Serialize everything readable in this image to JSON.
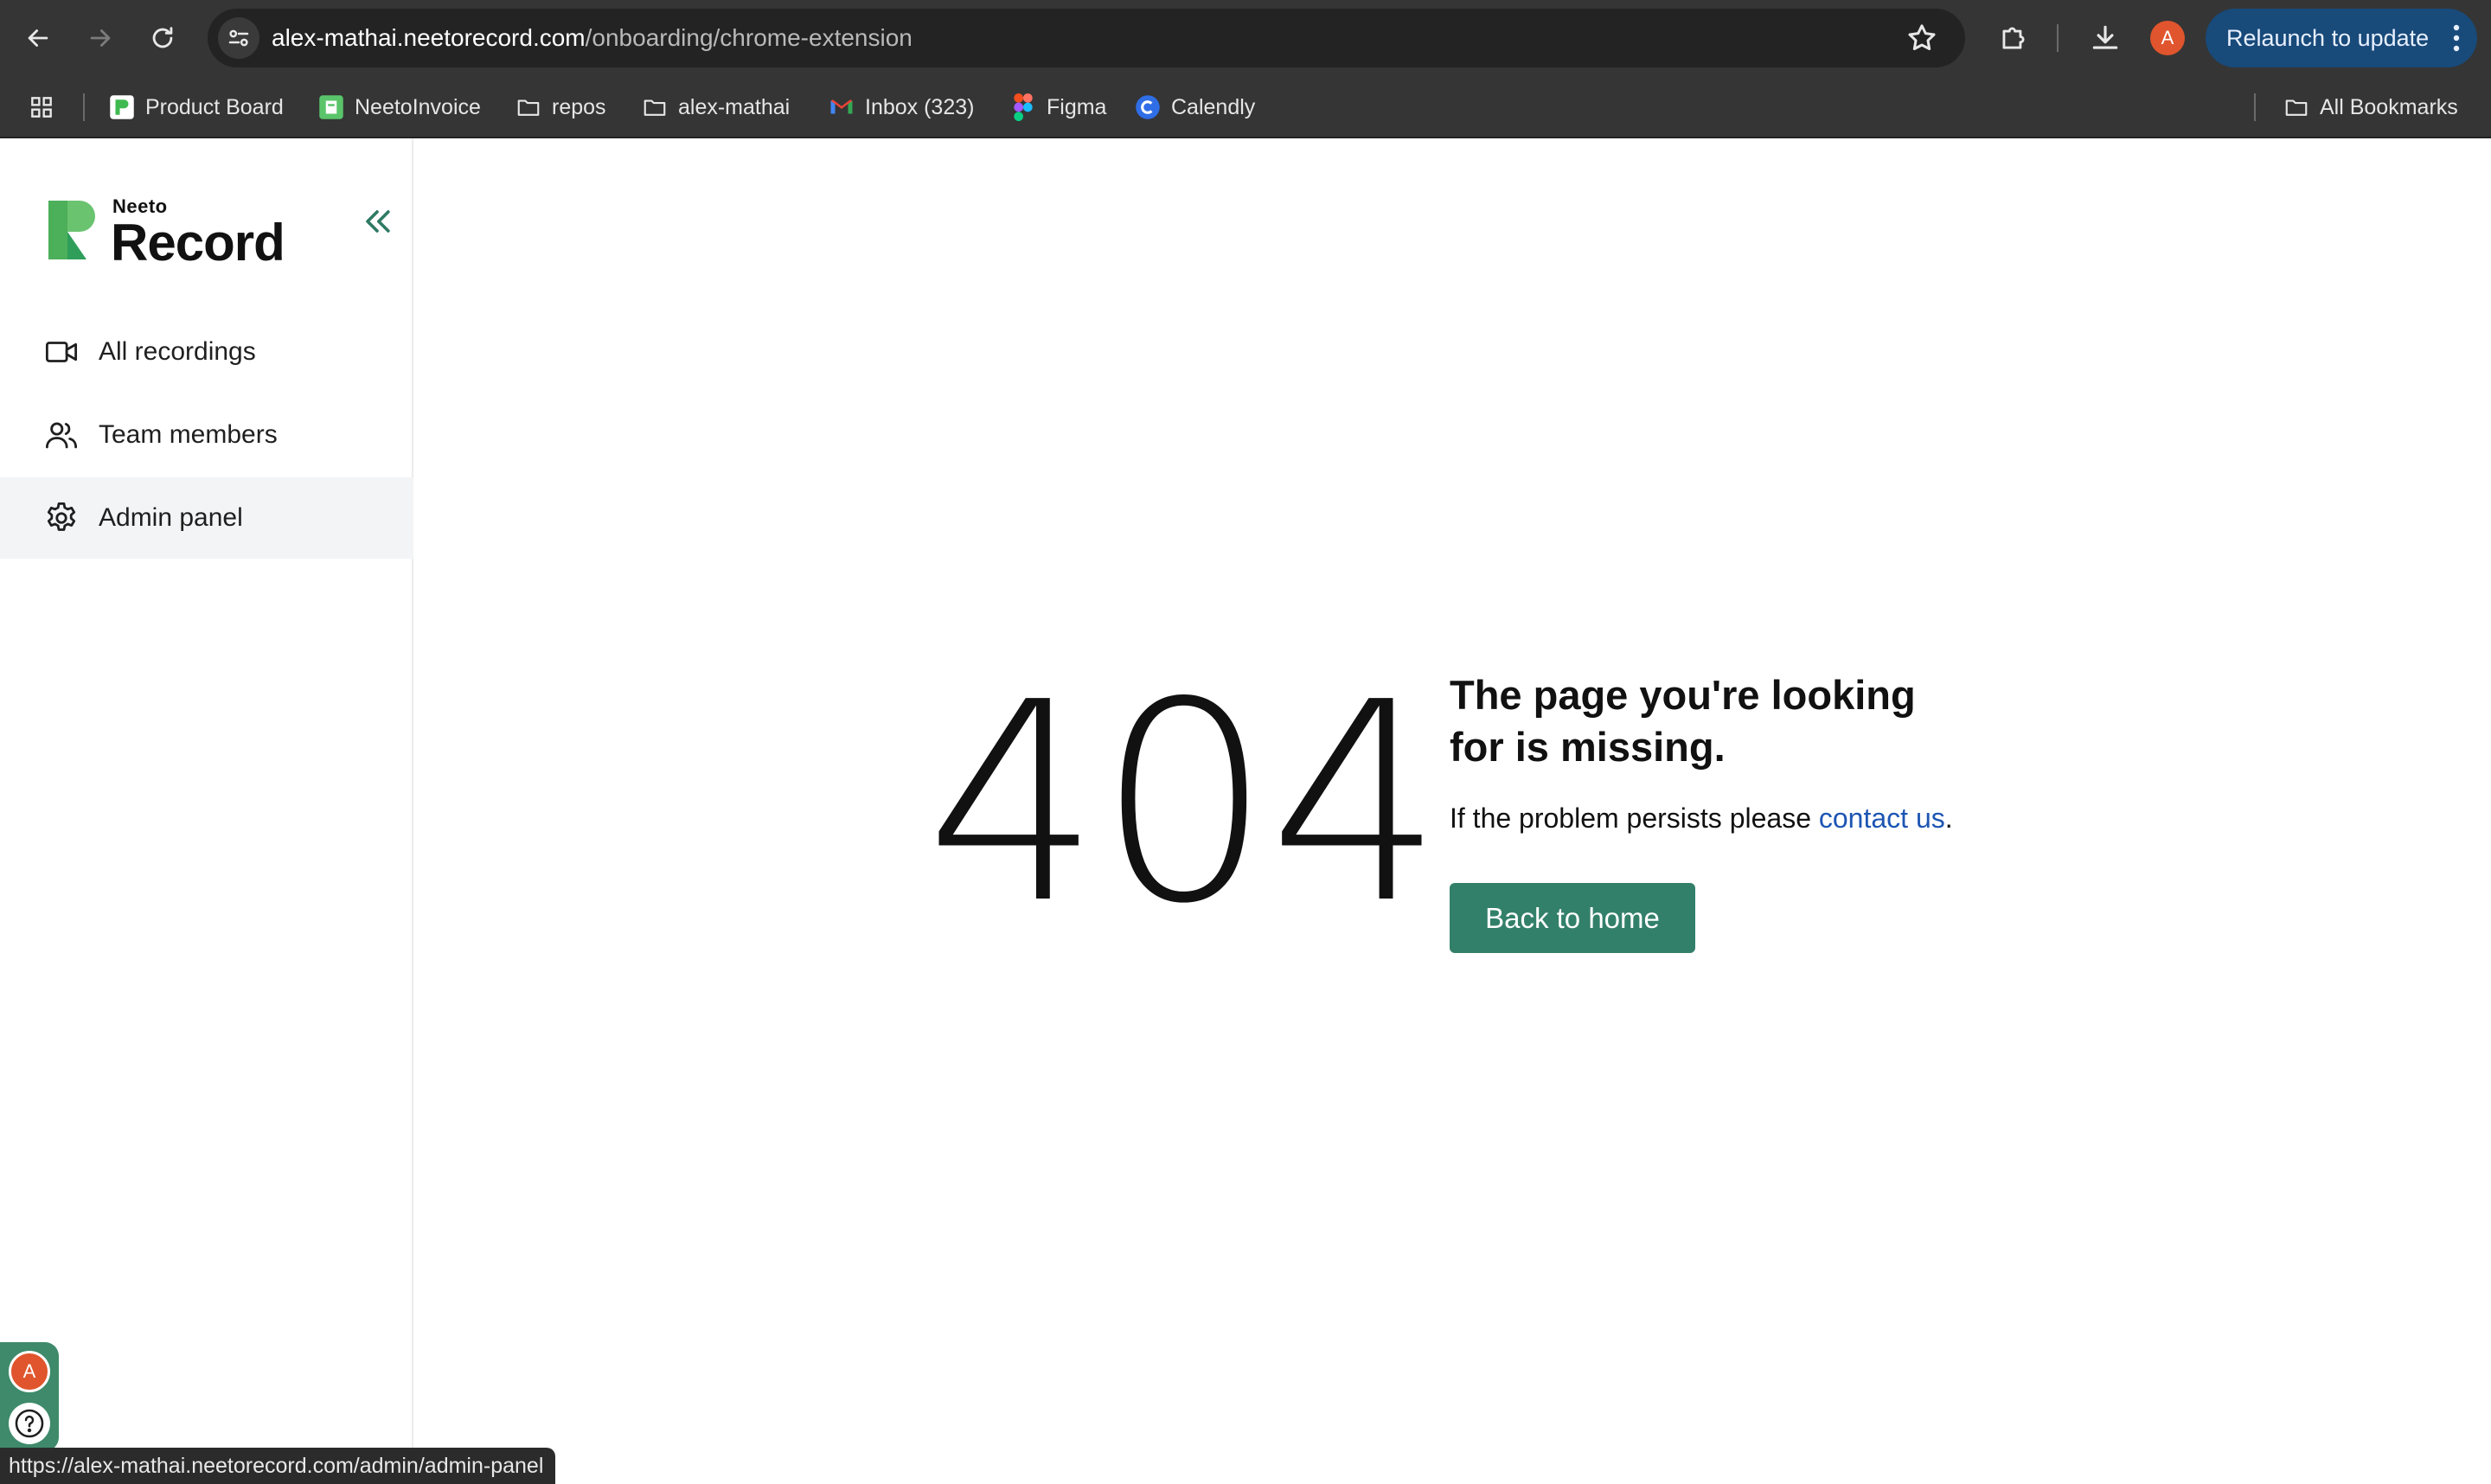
{
  "browser": {
    "url_host": "alex-mathai.neetorecord.com",
    "url_path": "/onboarding/chrome-extension",
    "profile_initial": "A",
    "relaunch_label": "Relaunch to update",
    "bookmarks": [
      {
        "label": "Product Board",
        "icon": "productboard-icon"
      },
      {
        "label": "NeetoInvoice",
        "icon": "neetoinvoice-icon"
      },
      {
        "label": "repos",
        "icon": "folder-icon"
      },
      {
        "label": "alex-mathai",
        "icon": "folder-icon"
      },
      {
        "label": "Inbox (323)",
        "icon": "gmail-icon"
      },
      {
        "label": "Figma",
        "icon": "figma-icon"
      },
      {
        "label": "Calendly",
        "icon": "calendly-icon"
      }
    ],
    "all_bookmarks_label": "All Bookmarks",
    "status_url": "https://alex-mathai.neetorecord.com/admin/admin-panel"
  },
  "sidebar": {
    "logo_small": "Neeto",
    "logo_big": "Record",
    "items": [
      {
        "label": "All recordings",
        "icon": "video-camera-icon"
      },
      {
        "label": "Team members",
        "icon": "users-icon"
      },
      {
        "label": "Admin panel",
        "icon": "gear-icon",
        "active": true
      }
    ],
    "user_initial": "A"
  },
  "main": {
    "code": "404",
    "title": "The page you're looking for is missing.",
    "message_prefix": "If the problem persists please ",
    "contact_link": "contact us",
    "message_suffix": ".",
    "back_button": "Back to home"
  },
  "colors": {
    "accent": "#33806a",
    "link": "#1d55b3",
    "chrome_bg": "#353535",
    "relaunch_bg": "#184a7a"
  }
}
